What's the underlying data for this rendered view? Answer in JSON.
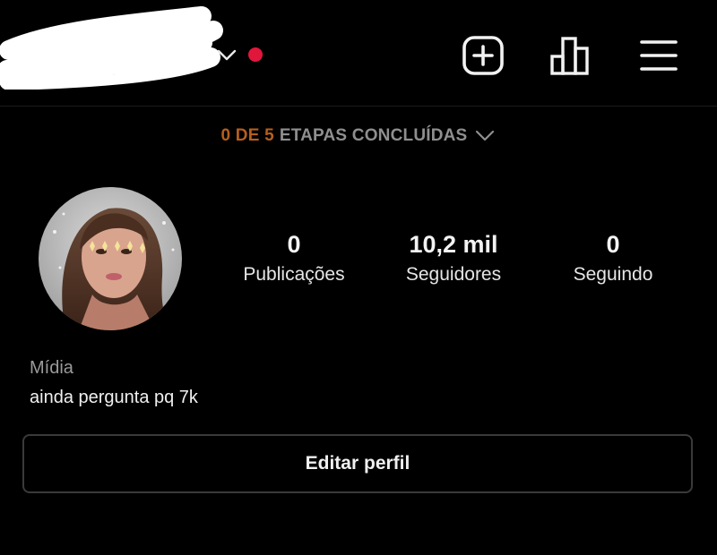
{
  "header": {
    "icons": {
      "account_switcher": "chevron-down-icon",
      "notification": "red-dot-badge",
      "new_post": "plus-square-icon",
      "insights": "bar-chart-icon",
      "menu": "hamburger-menu-icon"
    },
    "notification_color": "#e0173b"
  },
  "steps": {
    "count": "0 DE 5",
    "label": "ETAPAS CONCLUÍDAS",
    "count_color": "#b65f1c"
  },
  "profile": {
    "stats": [
      {
        "value": "0",
        "label": "Publicações"
      },
      {
        "value": "10,2 mil",
        "label": "Seguidores"
      },
      {
        "value": "0",
        "label": "Seguindo"
      }
    ],
    "category": "Mídia",
    "bio": "ainda pergunta pq 7k"
  },
  "actions": {
    "edit_profile": "Editar perfil"
  }
}
